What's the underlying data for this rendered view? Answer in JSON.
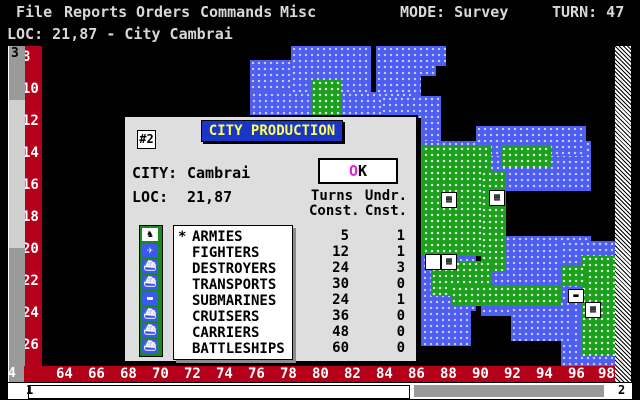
{
  "menu": {
    "items": [
      "File",
      "Reports",
      "Orders",
      "Commands",
      "Misc"
    ],
    "mode": "MODE: Survey",
    "turn": "TURN: 47"
  },
  "location_line": "LOC: 21,87 - City Cambrai",
  "rulers": {
    "rows": [
      "8",
      "10",
      "12",
      "14",
      "16",
      "18",
      "20",
      "22",
      "24",
      "26"
    ],
    "cols": [
      "64",
      "66",
      "68",
      "70",
      "72",
      "74",
      "76",
      "78",
      "80",
      "82",
      "84",
      "86",
      "88",
      "90",
      "92",
      "94",
      "96",
      "98"
    ],
    "vscroll_top": "3",
    "corner": "4",
    "hscroll_left": "1",
    "hscroll_right": "2"
  },
  "dialog": {
    "icon": "#2",
    "title": "CITY PRODUCTION",
    "city_label": "CITY:",
    "city_value": "Cambrai",
    "loc_label": "LOC:",
    "loc_value": "21,87",
    "ok_label": "OK",
    "col_turns": [
      "Turns",
      "Const."
    ],
    "col_undr": [
      "Undr.",
      "Cnst."
    ],
    "units": [
      {
        "mark": "*",
        "name": "ARMIES",
        "turns": "5",
        "under": "1",
        "icon": "army-icon"
      },
      {
        "mark": "",
        "name": "FIGHTERS",
        "turns": "12",
        "under": "1",
        "icon": "fighter-icon"
      },
      {
        "mark": "",
        "name": "DESTROYERS",
        "turns": "24",
        "under": "3",
        "icon": "destroyer-icon"
      },
      {
        "mark": "",
        "name": "TRANSPORTS",
        "turns": "30",
        "under": "0",
        "icon": "transport-icon"
      },
      {
        "mark": "",
        "name": "SUBMARINES",
        "turns": "24",
        "under": "1",
        "icon": "submarine-icon"
      },
      {
        "mark": "",
        "name": "CRUISERS",
        "turns": "36",
        "under": "0",
        "icon": "cruiser-icon"
      },
      {
        "mark": "",
        "name": "CARRIERS",
        "turns": "48",
        "under": "0",
        "icon": "carrier-icon"
      },
      {
        "mark": "",
        "name": "BATTLESHIPS",
        "turns": "60",
        "under": "0",
        "icon": "battleship-icon"
      }
    ]
  },
  "colors": {
    "sea": "#4e5ef0",
    "land": "#1ca11c",
    "ruler": "#b5001a",
    "title_bar": "#1a36c8",
    "title_text": "#ffff50",
    "ok_accent": "#e020e0"
  }
}
